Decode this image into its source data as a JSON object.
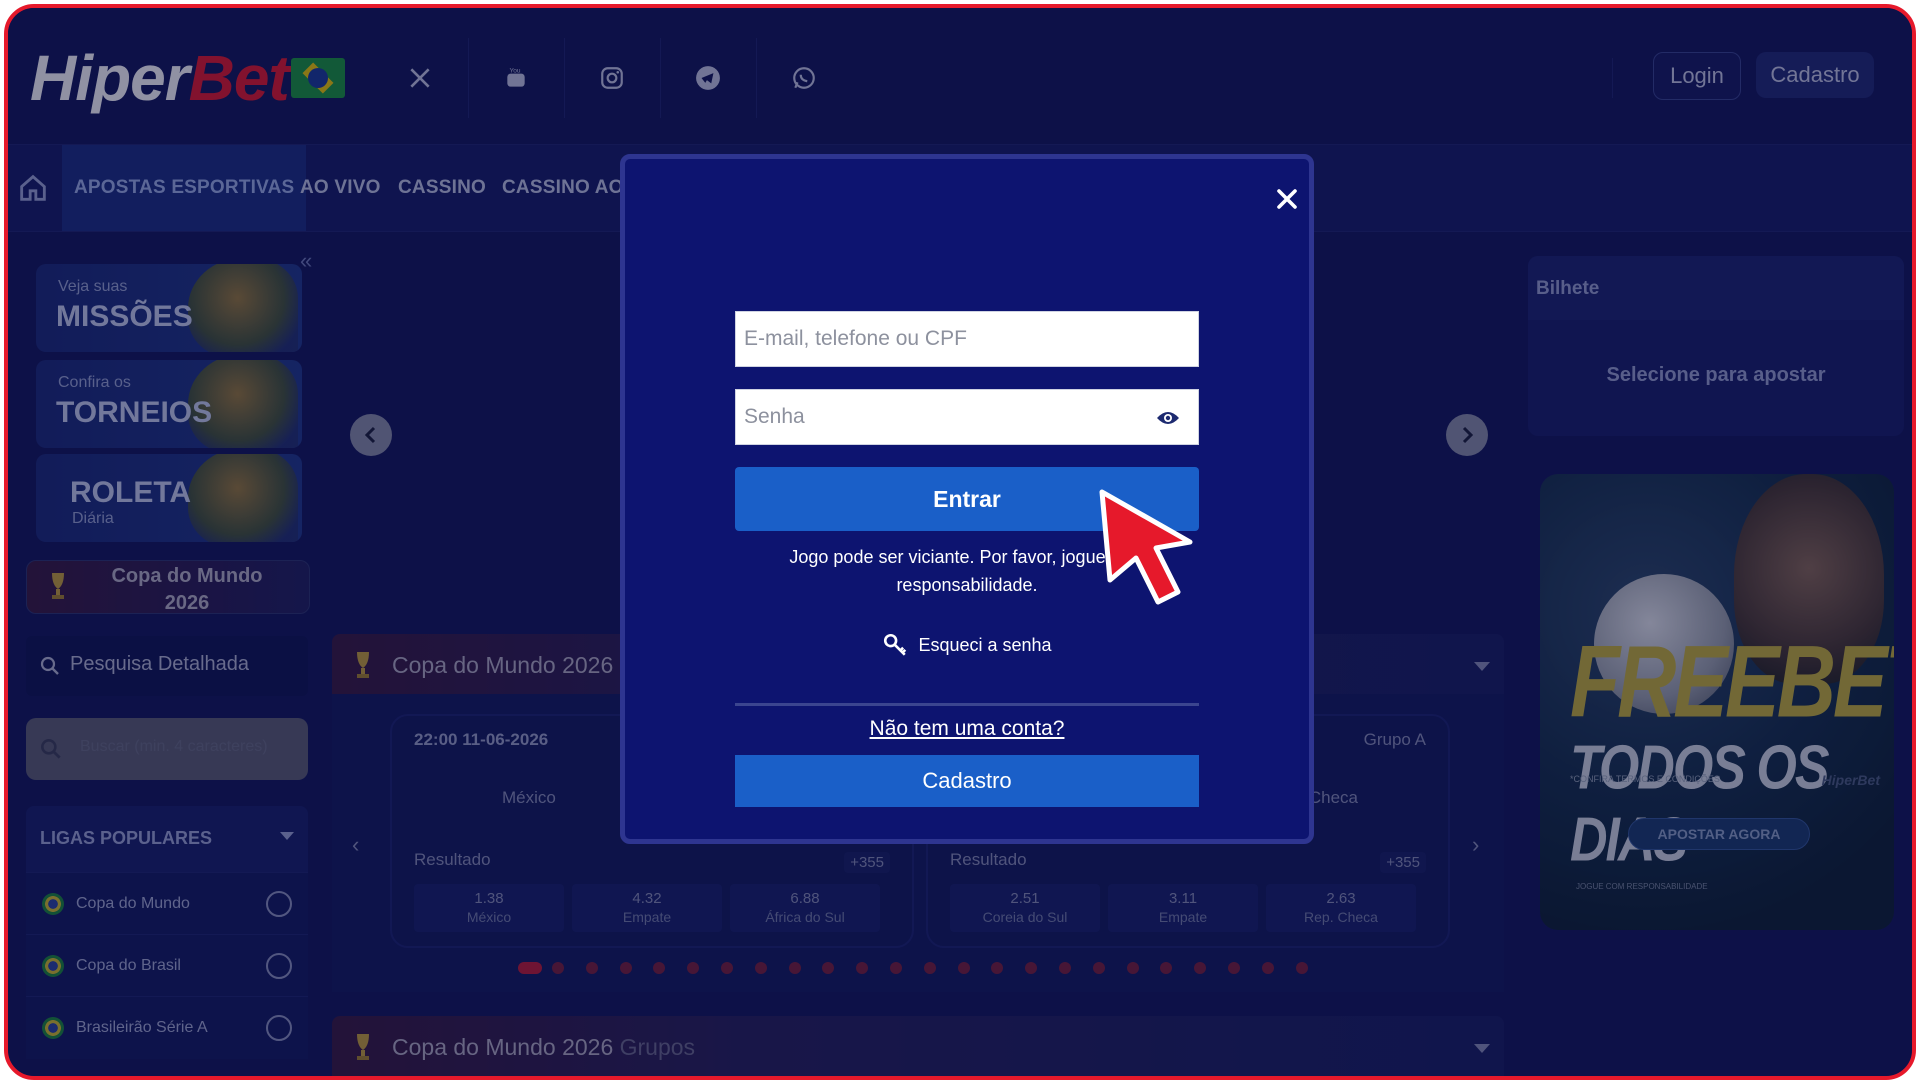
{
  "header": {
    "logo_part1": "Hiper",
    "logo_part2": "Bet",
    "login": "Login",
    "cadastro": "Cadastro"
  },
  "social_icons": [
    "x-icon",
    "youtube-icon",
    "instagram-icon",
    "telegram-icon",
    "whatsapp-icon"
  ],
  "nav": {
    "items": [
      "APOSTAS ESPORTIVAS",
      "AO VIVO",
      "CASSINO",
      "CASSINO AO"
    ]
  },
  "sidebar": {
    "promos": [
      {
        "small": "Veja suas",
        "big": "MISSÕES"
      },
      {
        "small": "Confira os",
        "big": "TORNEIOS"
      },
      {
        "big": "ROLETA",
        "small": "Diária"
      }
    ],
    "copa": "Copa do Mundo 2026",
    "search_label": "Pesquisa Detalhada",
    "search_placeholder": "Buscar (min. 4 caracteres)",
    "ligas_title": "LIGAS POPULARES",
    "ligas": [
      "Copa do Mundo",
      "Copa do Brasil",
      "Brasileirão Série A"
    ]
  },
  "bilhete": {
    "title": "Bilhete",
    "empty": "Selecione para apostar"
  },
  "banner": {
    "line1": "FREEBET",
    "line2": "TODOS OS DIAS",
    "terms": "*CONFIRA TERMOS E CONDIÇÕES",
    "cta": "APOSTAR AGORA",
    "responsible": "JOGUE COM RESPONSABILIDADE",
    "brand": "HiperBet"
  },
  "sections": [
    {
      "title": "Copa do Mundo 2026",
      "subtitle": ""
    },
    {
      "title": "Copa do Mundo 2026",
      "subtitle": "Grupos"
    }
  ],
  "matches": [
    {
      "time": "22:00  11-06-2026",
      "group": "",
      "team_a": "México",
      "team_b": "",
      "market": "Resultado",
      "more": "+355",
      "odds": [
        {
          "value": "1.38",
          "label": "México"
        },
        {
          "value": "4.32",
          "label": "Empate"
        },
        {
          "value": "6.88",
          "label": "África do Sul"
        }
      ]
    },
    {
      "time": "",
      "group": "Grupo A",
      "team_a": "",
      "team_b": "Checa",
      "market": "Resultado",
      "more": "+355",
      "odds": [
        {
          "value": "2.51",
          "label": "Coreia do Sul"
        },
        {
          "value": "3.11",
          "label": "Empate"
        },
        {
          "value": "2.63",
          "label": "Rep. Checa"
        }
      ]
    }
  ],
  "carousel": {
    "dot_count": 24,
    "active": 0
  },
  "modal": {
    "email_placeholder": "E-mail, telefone ou CPF",
    "password_placeholder": "Senha",
    "submit": "Entrar",
    "warning": "Jogo pode ser viciante. Por favor, jogue com responsabilidade.",
    "forgot": "Esqueci a senha",
    "no_account": "Não tem uma conta?",
    "register": "Cadastro"
  },
  "colors": {
    "accent_red": "#e6192b",
    "primary_blue": "#1a5fc8",
    "bg_navy": "#11175a",
    "modal_bg": "#0d1470"
  }
}
